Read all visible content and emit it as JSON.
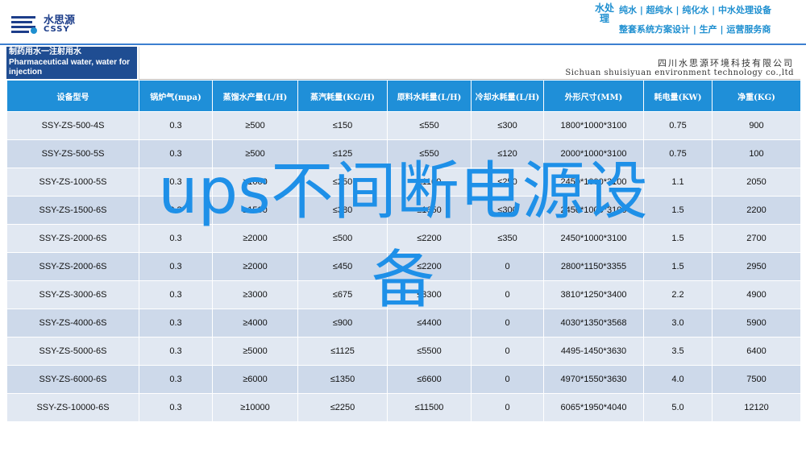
{
  "brand": {
    "name_cn": "水思源",
    "name_en": "CSSY",
    "tag": "水处理",
    "slogan_line1": "纯水 | 超纯水 | 纯化水 | 中水处理设备",
    "slogan_line2": "整套系统方案设计 | 生产 | 运营服务商",
    "accent_color": "#1e8fd0",
    "logo_icon": "water-drop-logo-icon"
  },
  "header": {
    "title_cn": "制药用水一注射用水",
    "title_en_line1": "Pharmaceutical water, water for",
    "title_en_line2": "injection",
    "company_cn": "四川水思源环境科技有限公司",
    "company_en": "Sichuan shuisiyuan environment technology co.,ltd"
  },
  "table": {
    "columns": [
      "设备型号",
      "锅炉气(mpa)",
      "蒸馏水产量(L/H)",
      "蒸汽耗量(KG/H)",
      "原料水耗量(L/H)",
      "冷却水耗量(L/H)",
      "外形尺寸(MM)",
      "耗电量(KW)",
      "净重(KG)"
    ],
    "rows": [
      [
        "SSY-ZS-500-4S",
        "0.3",
        "≥500",
        "≤150",
        "≤550",
        "≤300",
        "1800*1000*3100",
        "0.75",
        "900"
      ],
      [
        "SSY-ZS-500-5S",
        "0.3",
        "≥500",
        "≤125",
        "≤550",
        "≤120",
        "2000*1000*3100",
        "0.75",
        "100"
      ],
      [
        "SSY-ZS-1000-5S",
        "0.3",
        "≥1000",
        "≤250",
        "≤1100",
        "≤250",
        "2450*1000*3100",
        "1.1",
        "2050"
      ],
      [
        "SSY-ZS-1500-6S",
        "0.3",
        "≥1500",
        "≤380",
        "≤1650",
        "≤300",
        "2450*1000*3100",
        "1.5",
        "2200"
      ],
      [
        "SSY-ZS-2000-6S",
        "0.3",
        "≥2000",
        "≤500",
        "≤2200",
        "≤350",
        "2450*1000*3100",
        "1.5",
        "2700"
      ],
      [
        "SSY-ZS-2000-6S",
        "0.3",
        "≥2000",
        "≤450",
        "≤2200",
        "0",
        "2800*1150*3355",
        "1.5",
        "2950"
      ],
      [
        "SSY-ZS-3000-6S",
        "0.3",
        "≥3000",
        "≤675",
        "≤3300",
        "0",
        "3810*1250*3400",
        "2.2",
        "4900"
      ],
      [
        "SSY-ZS-4000-6S",
        "0.3",
        "≥4000",
        "≤900",
        "≤4400",
        "0",
        "4030*1350*3568",
        "3.0",
        "5900"
      ],
      [
        "SSY-ZS-5000-6S",
        "0.3",
        "≥5000",
        "≤1125",
        "≤5500",
        "0",
        "4495-1450*3630",
        "3.5",
        "6400"
      ],
      [
        "SSY-ZS-6000-6S",
        "0.3",
        "≥6000",
        "≤1350",
        "≤6600",
        "0",
        "4970*1550*3630",
        "4.0",
        "7500"
      ],
      [
        "SSY-ZS-10000-6S",
        "0.3",
        "≥10000",
        "≤2250",
        "≤11500",
        "0",
        "6065*1950*4040",
        "5.0",
        "12120"
      ]
    ]
  },
  "overlay": {
    "line1": "ups不间断电源设",
    "line2": "备",
    "color": "#1e90e8"
  }
}
